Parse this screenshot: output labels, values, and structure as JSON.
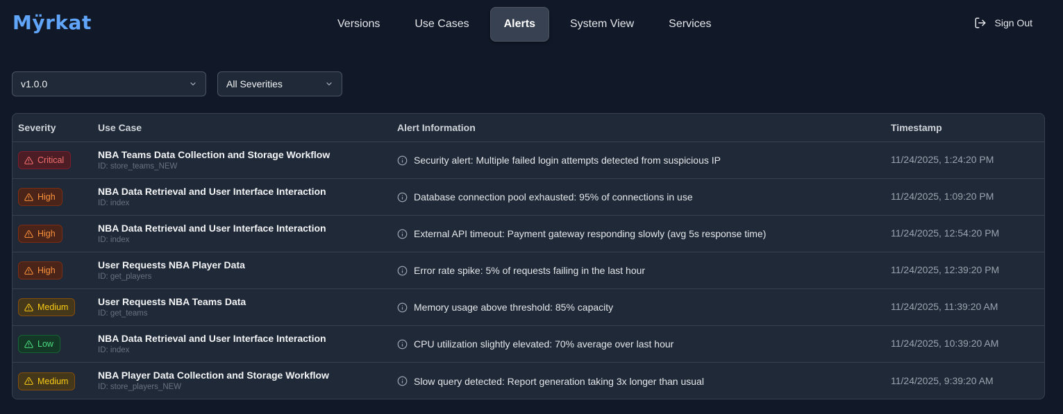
{
  "app": {
    "logo": "Mÿrkat",
    "accent_color": "#60a5fa"
  },
  "nav": {
    "tabs": [
      {
        "label": "Versions",
        "active": false
      },
      {
        "label": "Use Cases",
        "active": false
      },
      {
        "label": "Alerts",
        "active": true
      },
      {
        "label": "System View",
        "active": false
      },
      {
        "label": "Services",
        "active": false
      }
    ],
    "sign_out": {
      "label": "Sign Out",
      "icon": "sign-out-icon"
    }
  },
  "filters": {
    "version": {
      "selected": "v1.0.0",
      "icon": "chevron-down-icon"
    },
    "severity": {
      "selected": "All Severities",
      "icon": "chevron-down-icon"
    }
  },
  "table": {
    "headers": {
      "severity": "Severity",
      "use_case": "Use Case",
      "alert_info": "Alert Information",
      "timestamp": "Timestamp"
    },
    "severity_colors": {
      "Critical": "#f87171",
      "High": "#fb923c",
      "Medium": "#facc15",
      "Low": "#4ade80"
    },
    "rows": [
      {
        "severity": "Critical",
        "level": "critical",
        "use_case": "NBA Teams Data Collection and Storage Workflow",
        "id": "ID: store_teams_NEW",
        "info": "Security alert: Multiple failed login attempts detected from suspicious IP",
        "timestamp": "11/24/2025, 1:24:20 PM"
      },
      {
        "severity": "High",
        "level": "high",
        "use_case": "NBA Data Retrieval and User Interface Interaction",
        "id": "ID: index",
        "info": "Database connection pool exhausted: 95% of connections in use",
        "timestamp": "11/24/2025, 1:09:20 PM"
      },
      {
        "severity": "High",
        "level": "high",
        "use_case": "NBA Data Retrieval and User Interface Interaction",
        "id": "ID: index",
        "info": "External API timeout: Payment gateway responding slowly (avg 5s response time)",
        "timestamp": "11/24/2025, 12:54:20 PM"
      },
      {
        "severity": "High",
        "level": "high",
        "use_case": "User Requests NBA Player Data",
        "id": "ID: get_players",
        "info": "Error rate spike: 5% of requests failing in the last hour",
        "timestamp": "11/24/2025, 12:39:20 PM"
      },
      {
        "severity": "Medium",
        "level": "medium",
        "use_case": "User Requests NBA Teams Data",
        "id": "ID: get_teams",
        "info": "Memory usage above threshold: 85% capacity",
        "timestamp": "11/24/2025, 11:39:20 AM"
      },
      {
        "severity": "Low",
        "level": "low",
        "use_case": "NBA Data Retrieval and User Interface Interaction",
        "id": "ID: index",
        "info": "CPU utilization slightly elevated: 70% average over last hour",
        "timestamp": "11/24/2025, 10:39:20 AM"
      },
      {
        "severity": "Medium",
        "level": "medium",
        "use_case": "NBA Player Data Collection and Storage Workflow",
        "id": "ID: store_players_NEW",
        "info": "Slow query detected: Report generation taking 3x longer than usual",
        "timestamp": "11/24/2025, 9:39:20 AM"
      }
    ]
  }
}
